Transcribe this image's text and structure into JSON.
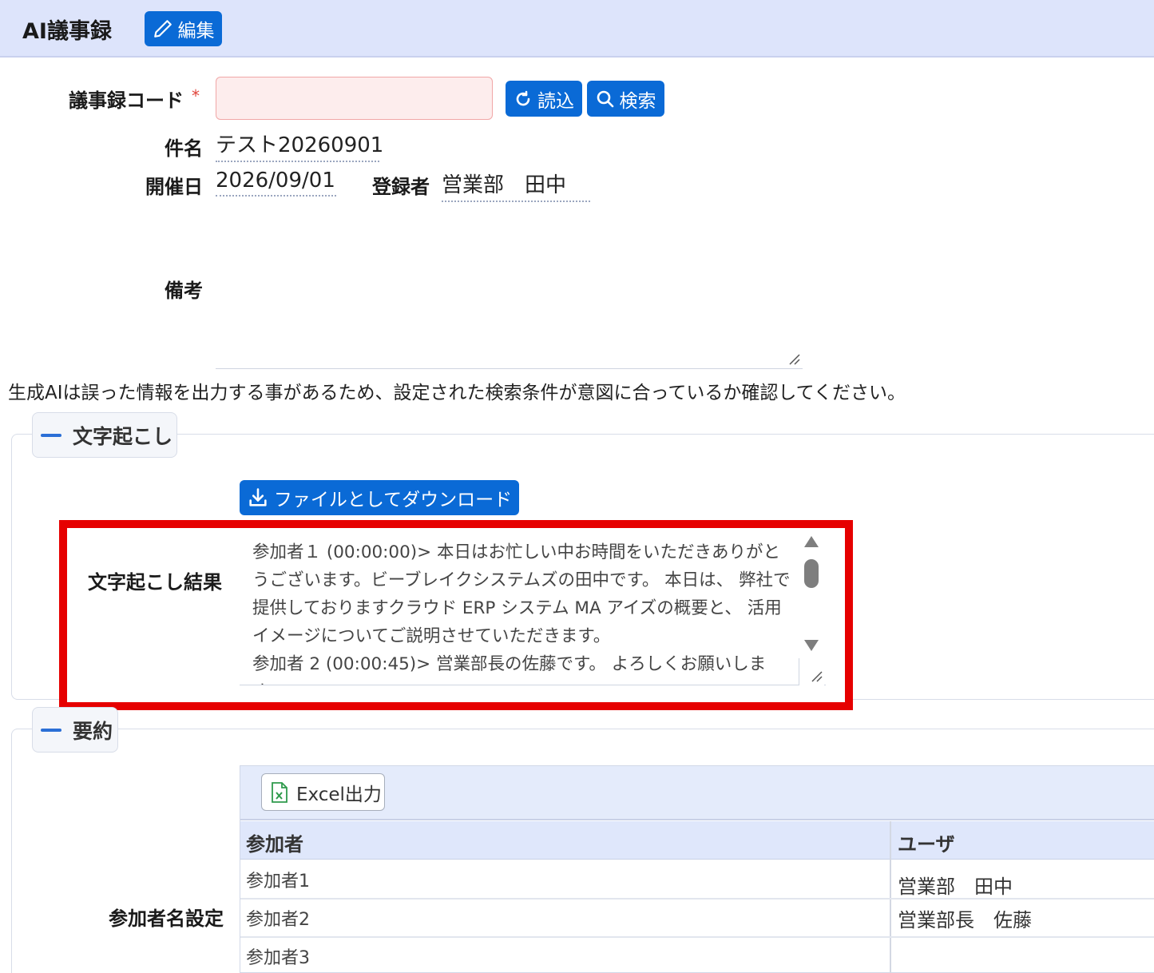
{
  "header": {
    "title": "AI議事録",
    "edit_label": "編集"
  },
  "form": {
    "code_label": "議事録コード",
    "required_mark": "*",
    "code_value": "",
    "load_label": "読込",
    "search_label": "検索",
    "subject_label": "件名",
    "subject_value": "テスト20260901",
    "date_label": "開催日",
    "date_value": "2026/09/01",
    "registrant_label": "登録者",
    "registrant_value": "営業部　田中",
    "remarks_label": "備考",
    "remarks_value": ""
  },
  "notice": "生成AIは誤った情報を出力する事があるため、設定された検索条件が意図に合っているか確認してください。",
  "transcription": {
    "section_title": "文字起こし",
    "download_label": "ファイルとしてダウンロード",
    "result_label": "文字起こし結果",
    "text": "参加者１ (00:00:00)> 本日はお忙しい中お時間をいただきありがとうございます。ビーブレイクシステムズの田中です。 本日は、 弊社で提供しておりますクラウド ERP システム MA アイズの概要と、 活用イメージについてご説明させていただきます。\n参加者 2 (00:00:45)> 営業部長の佐藤です。 よろしくお願いします。"
  },
  "summary": {
    "section_title": "要約",
    "excel_label": "Excel出力",
    "participant_setting_label": "参加者名設定",
    "columns": [
      "参加者",
      "ユーザ"
    ],
    "rows": [
      {
        "participant": "参加者1",
        "user": "営業部　田中"
      },
      {
        "participant": "参加者2",
        "user": "営業部長　佐藤"
      },
      {
        "participant": "参加者3",
        "user": ""
      }
    ]
  },
  "colors": {
    "primary": "#0a6ad6",
    "header_bg": "#dde4fb",
    "highlight": "#e60000",
    "required_input_bg": "#fdeded"
  }
}
